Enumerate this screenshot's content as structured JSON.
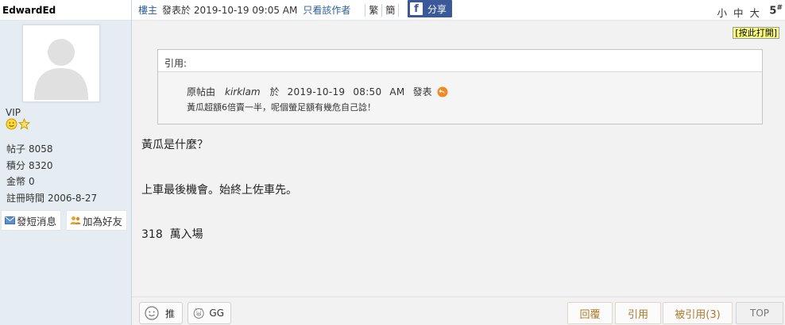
{
  "user": {
    "name": "EdwardEd",
    "rank": "VIP",
    "stats": [
      {
        "key": "帖子",
        "value": "8058"
      },
      {
        "key": "積分",
        "value": "8320"
      },
      {
        "key": "金幣",
        "value": "0"
      },
      {
        "key": "註冊時間",
        "value": "2006-8-27"
      }
    ],
    "pm_label": "發短消息",
    "friend_label": "加為好友"
  },
  "post": {
    "op_label": "樓主",
    "posted_text": "發表於 2019-10-19 09:05 AM",
    "author_only": "只看該作者",
    "trad": "繁",
    "simp": "簡",
    "share_label": "分享",
    "font_sizes": [
      "小",
      "中",
      "大"
    ],
    "floor": "5",
    "floor_mark": "#",
    "print_label": "[按此打開]",
    "quote": {
      "header": "引用:",
      "pre": "原帖由",
      "author": "kirklam",
      "at": "於",
      "date": "2019-10-19",
      "time": "08:50",
      "ampm": "AM",
      "post_word": "發表",
      "text": "黃瓜超額6倍賣一半，呢個螢足額有幾危自己諗！"
    },
    "lines": [
      "黃瓜是什麼？",
      "上車最後機會。始終上佐車先。",
      "318  萬入場"
    ]
  },
  "actions": {
    "recommend": "推",
    "gg": "GG",
    "reply": "回覆",
    "quote": "引用",
    "quoted": "被引用(3)",
    "top": "TOP"
  }
}
